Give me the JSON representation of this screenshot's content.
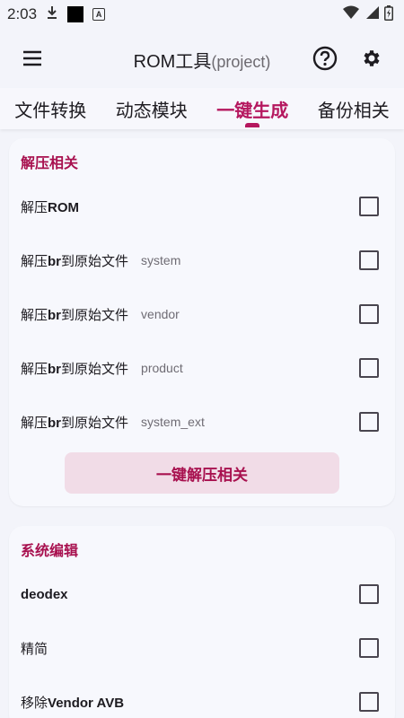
{
  "status_bar": {
    "time": "2:03",
    "notif_letter": "A"
  },
  "app_bar": {
    "title_main": "ROM工具",
    "title_sub": "(project)"
  },
  "tabs": [
    {
      "label": "文件转换",
      "active": false
    },
    {
      "label": "动态模块",
      "active": false
    },
    {
      "label": "一键生成",
      "active": true
    },
    {
      "label": "备份相关",
      "active": false
    }
  ],
  "sections": [
    {
      "title": "解压相关",
      "rows": [
        {
          "label": "解压ROM",
          "sub": "",
          "checked": false
        },
        {
          "label": "解压br到原始文件",
          "sub": "system",
          "checked": false
        },
        {
          "label": "解压br到原始文件",
          "sub": "vendor",
          "checked": false
        },
        {
          "label": "解压br到原始文件",
          "sub": "product",
          "checked": false
        },
        {
          "label": "解压br到原始文件",
          "sub": "system_ext",
          "checked": false
        }
      ],
      "action": "一键解压相关"
    },
    {
      "title": "系统编辑",
      "rows": [
        {
          "label": "deodex",
          "sub": "",
          "checked": false
        },
        {
          "label": "精简",
          "sub": "",
          "checked": false
        },
        {
          "label": "移除Vendor AVB",
          "sub": "",
          "checked": false
        }
      ]
    }
  ],
  "colors": {
    "accent": "#b5175e",
    "section_title": "#a8114f",
    "action_bg": "#f1dce7"
  }
}
